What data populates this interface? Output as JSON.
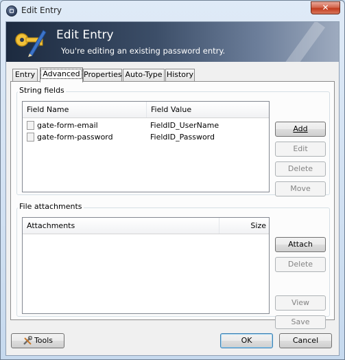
{
  "window": {
    "title": "Edit Entry",
    "close_label": "✕"
  },
  "banner": {
    "title": "Edit Entry",
    "subtitle": "You're editing an existing password entry."
  },
  "tabs": [
    {
      "label": "Entry",
      "active": false
    },
    {
      "label": "Advanced",
      "active": true
    },
    {
      "label": "Properties",
      "active": false
    },
    {
      "label": "Auto-Type",
      "active": false
    },
    {
      "label": "History",
      "active": false
    }
  ],
  "string_fields": {
    "group_label": "String fields",
    "columns": [
      "Field Name",
      "Field Value"
    ],
    "rows": [
      {
        "name": "gate-form-email",
        "value": "FieldID_UserName"
      },
      {
        "name": "gate-form-password",
        "value": "FieldID_Password"
      }
    ],
    "buttons": {
      "add": "Add",
      "edit": "Edit",
      "delete": "Delete",
      "move": "Move"
    }
  },
  "file_attachments": {
    "group_label": "File attachments",
    "columns": [
      "Attachments",
      "Size"
    ],
    "buttons": {
      "attach": "Attach",
      "delete": "Delete",
      "view": "View",
      "save": "Save"
    }
  },
  "footer": {
    "tools": "Tools",
    "ok": "OK",
    "cancel": "Cancel"
  },
  "colors": {
    "banner_dark": "#1c2a3f",
    "close_red": "#c23b1e",
    "default_button_border": "#3c7fb1"
  }
}
